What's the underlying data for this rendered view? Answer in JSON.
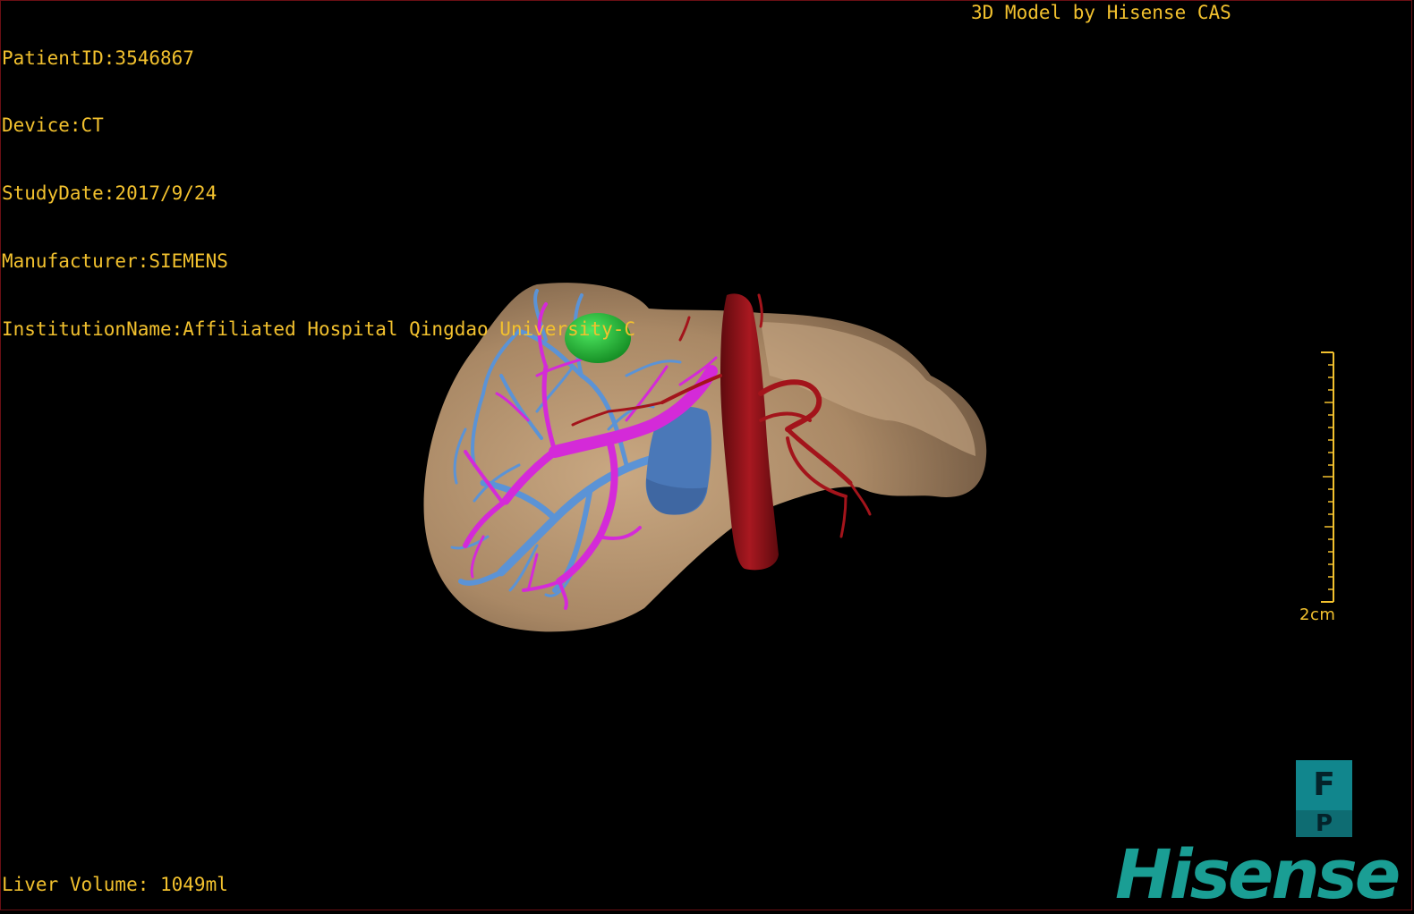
{
  "overlay": {
    "patient_id": "PatientID:3546867",
    "device": "Device:CT",
    "study_date": "StudyDate:2017/9/24",
    "manufacturer": "Manufacturer:SIEMENS",
    "institution": "InstitutionName:Affiliated Hospital Qingdao University-C",
    "credit": "3D Model by Hisense CAS",
    "liver_volume": "Liver Volume: 1049ml"
  },
  "scale_bar": {
    "label": "2cm"
  },
  "orientation": {
    "top_letter": "F",
    "bottom_letter": "P"
  },
  "logo": {
    "text": "Hisense"
  },
  "colors": {
    "text": "#f2c12e",
    "liver": "#b59670",
    "portal_vein": "#d42ad8",
    "hepatic_vein": "#5b93d6",
    "ivc": "#8b1016",
    "artery": "#a3141b",
    "tumor": "#22a830",
    "brand": "#1a9e94"
  }
}
